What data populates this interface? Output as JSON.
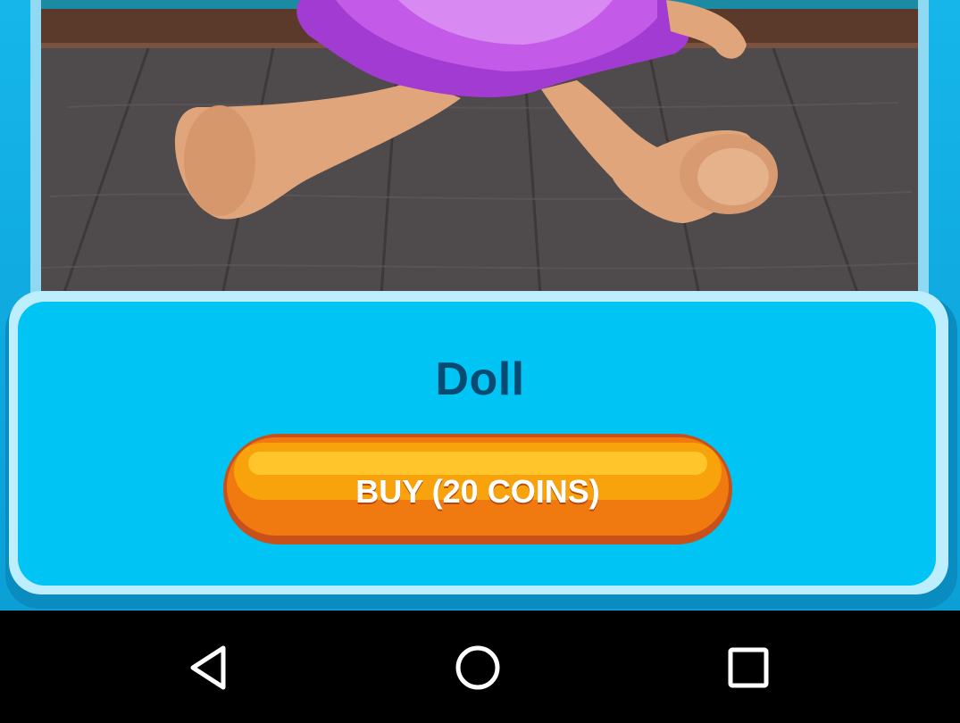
{
  "item": {
    "name": "Doll",
    "picture_icon": "doll-illustration"
  },
  "buy_button": {
    "label": "BUY (20 COINS)"
  },
  "navigation_bar": {
    "back_icon": "back-triangle-icon",
    "home_icon": "home-circle-icon",
    "recents_icon": "recents-square-icon"
  },
  "colors": {
    "panel": "#00c4f4",
    "title_text": "#074a72",
    "button_orange": "#f07a10",
    "nav_bar": "#000000"
  }
}
